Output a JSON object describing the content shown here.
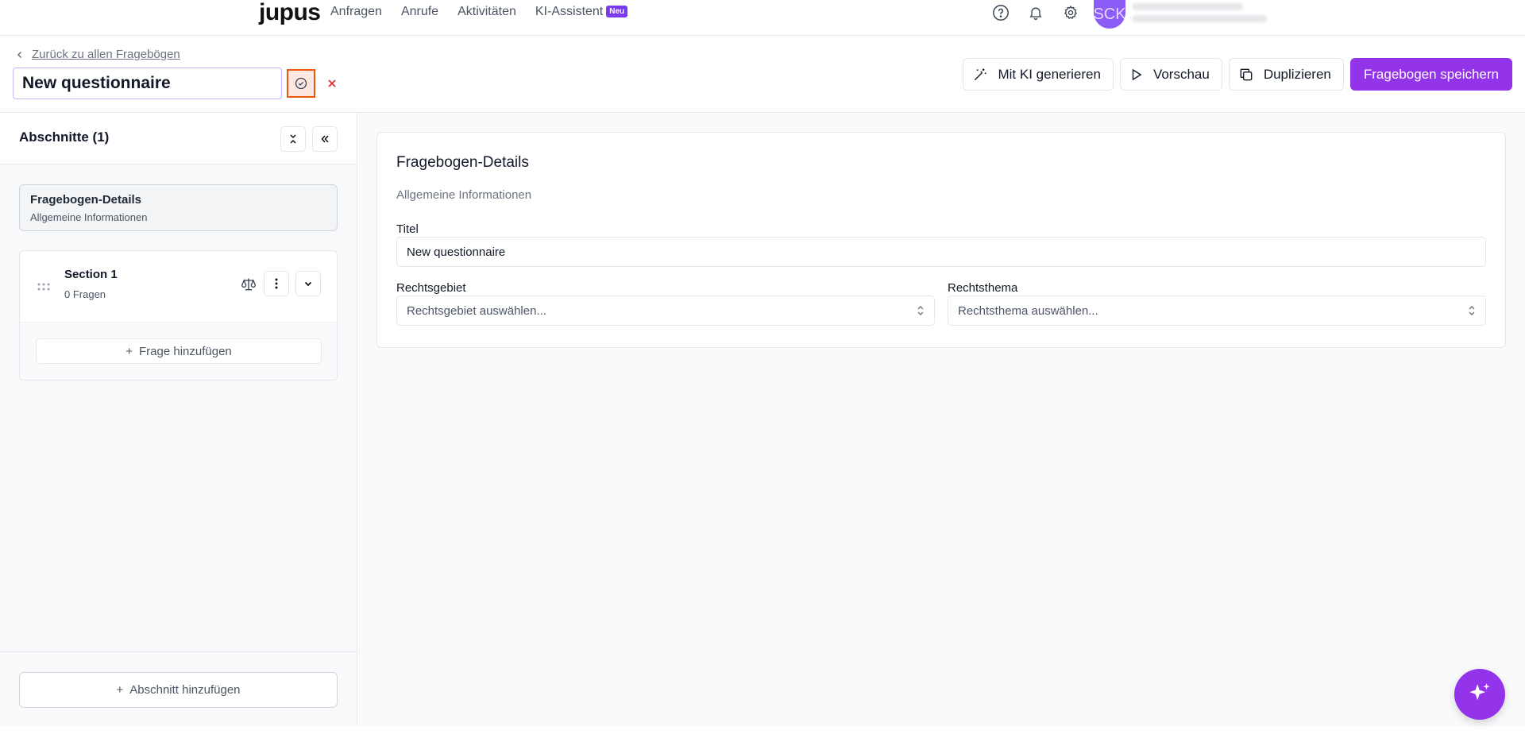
{
  "brand": {
    "logo": "jupus"
  },
  "nav": {
    "links": [
      "Anfragen",
      "Anrufe",
      "Aktivitäten",
      "KI-Assistent"
    ],
    "badge": "Neu",
    "avatar_initials": "SCK"
  },
  "header": {
    "back_label": "Zurück zu allen Fragebögen",
    "title_value": "New questionnaire",
    "actions": {
      "generate": "Mit KI generieren",
      "preview": "Vorschau",
      "duplicate": "Duplizieren",
      "save": "Fragebogen speichern"
    }
  },
  "sidebar": {
    "title": "Abschnitte (1)",
    "details_card": {
      "title": "Fragebogen-Details",
      "subtitle": "Allgemeine Informationen"
    },
    "sections": [
      {
        "name": "Section 1",
        "count": "0 Fragen",
        "add_question": "Frage hinzufügen"
      }
    ],
    "add_section": "Abschnitt hinzufügen"
  },
  "main": {
    "panel_title": "Fragebogen-Details",
    "panel_subtitle": "Allgemeine Informationen",
    "title_label": "Titel",
    "title_value": "New questionnaire",
    "area_label": "Rechtsgebiet",
    "area_placeholder": "Rechtsgebiet auswählen...",
    "topic_label": "Rechtsthema",
    "topic_placeholder": "Rechtsthema auswählen..."
  },
  "colors": {
    "accent": "#9333ea",
    "focus_border": "#ea580c",
    "cancel": "#dc2626"
  }
}
